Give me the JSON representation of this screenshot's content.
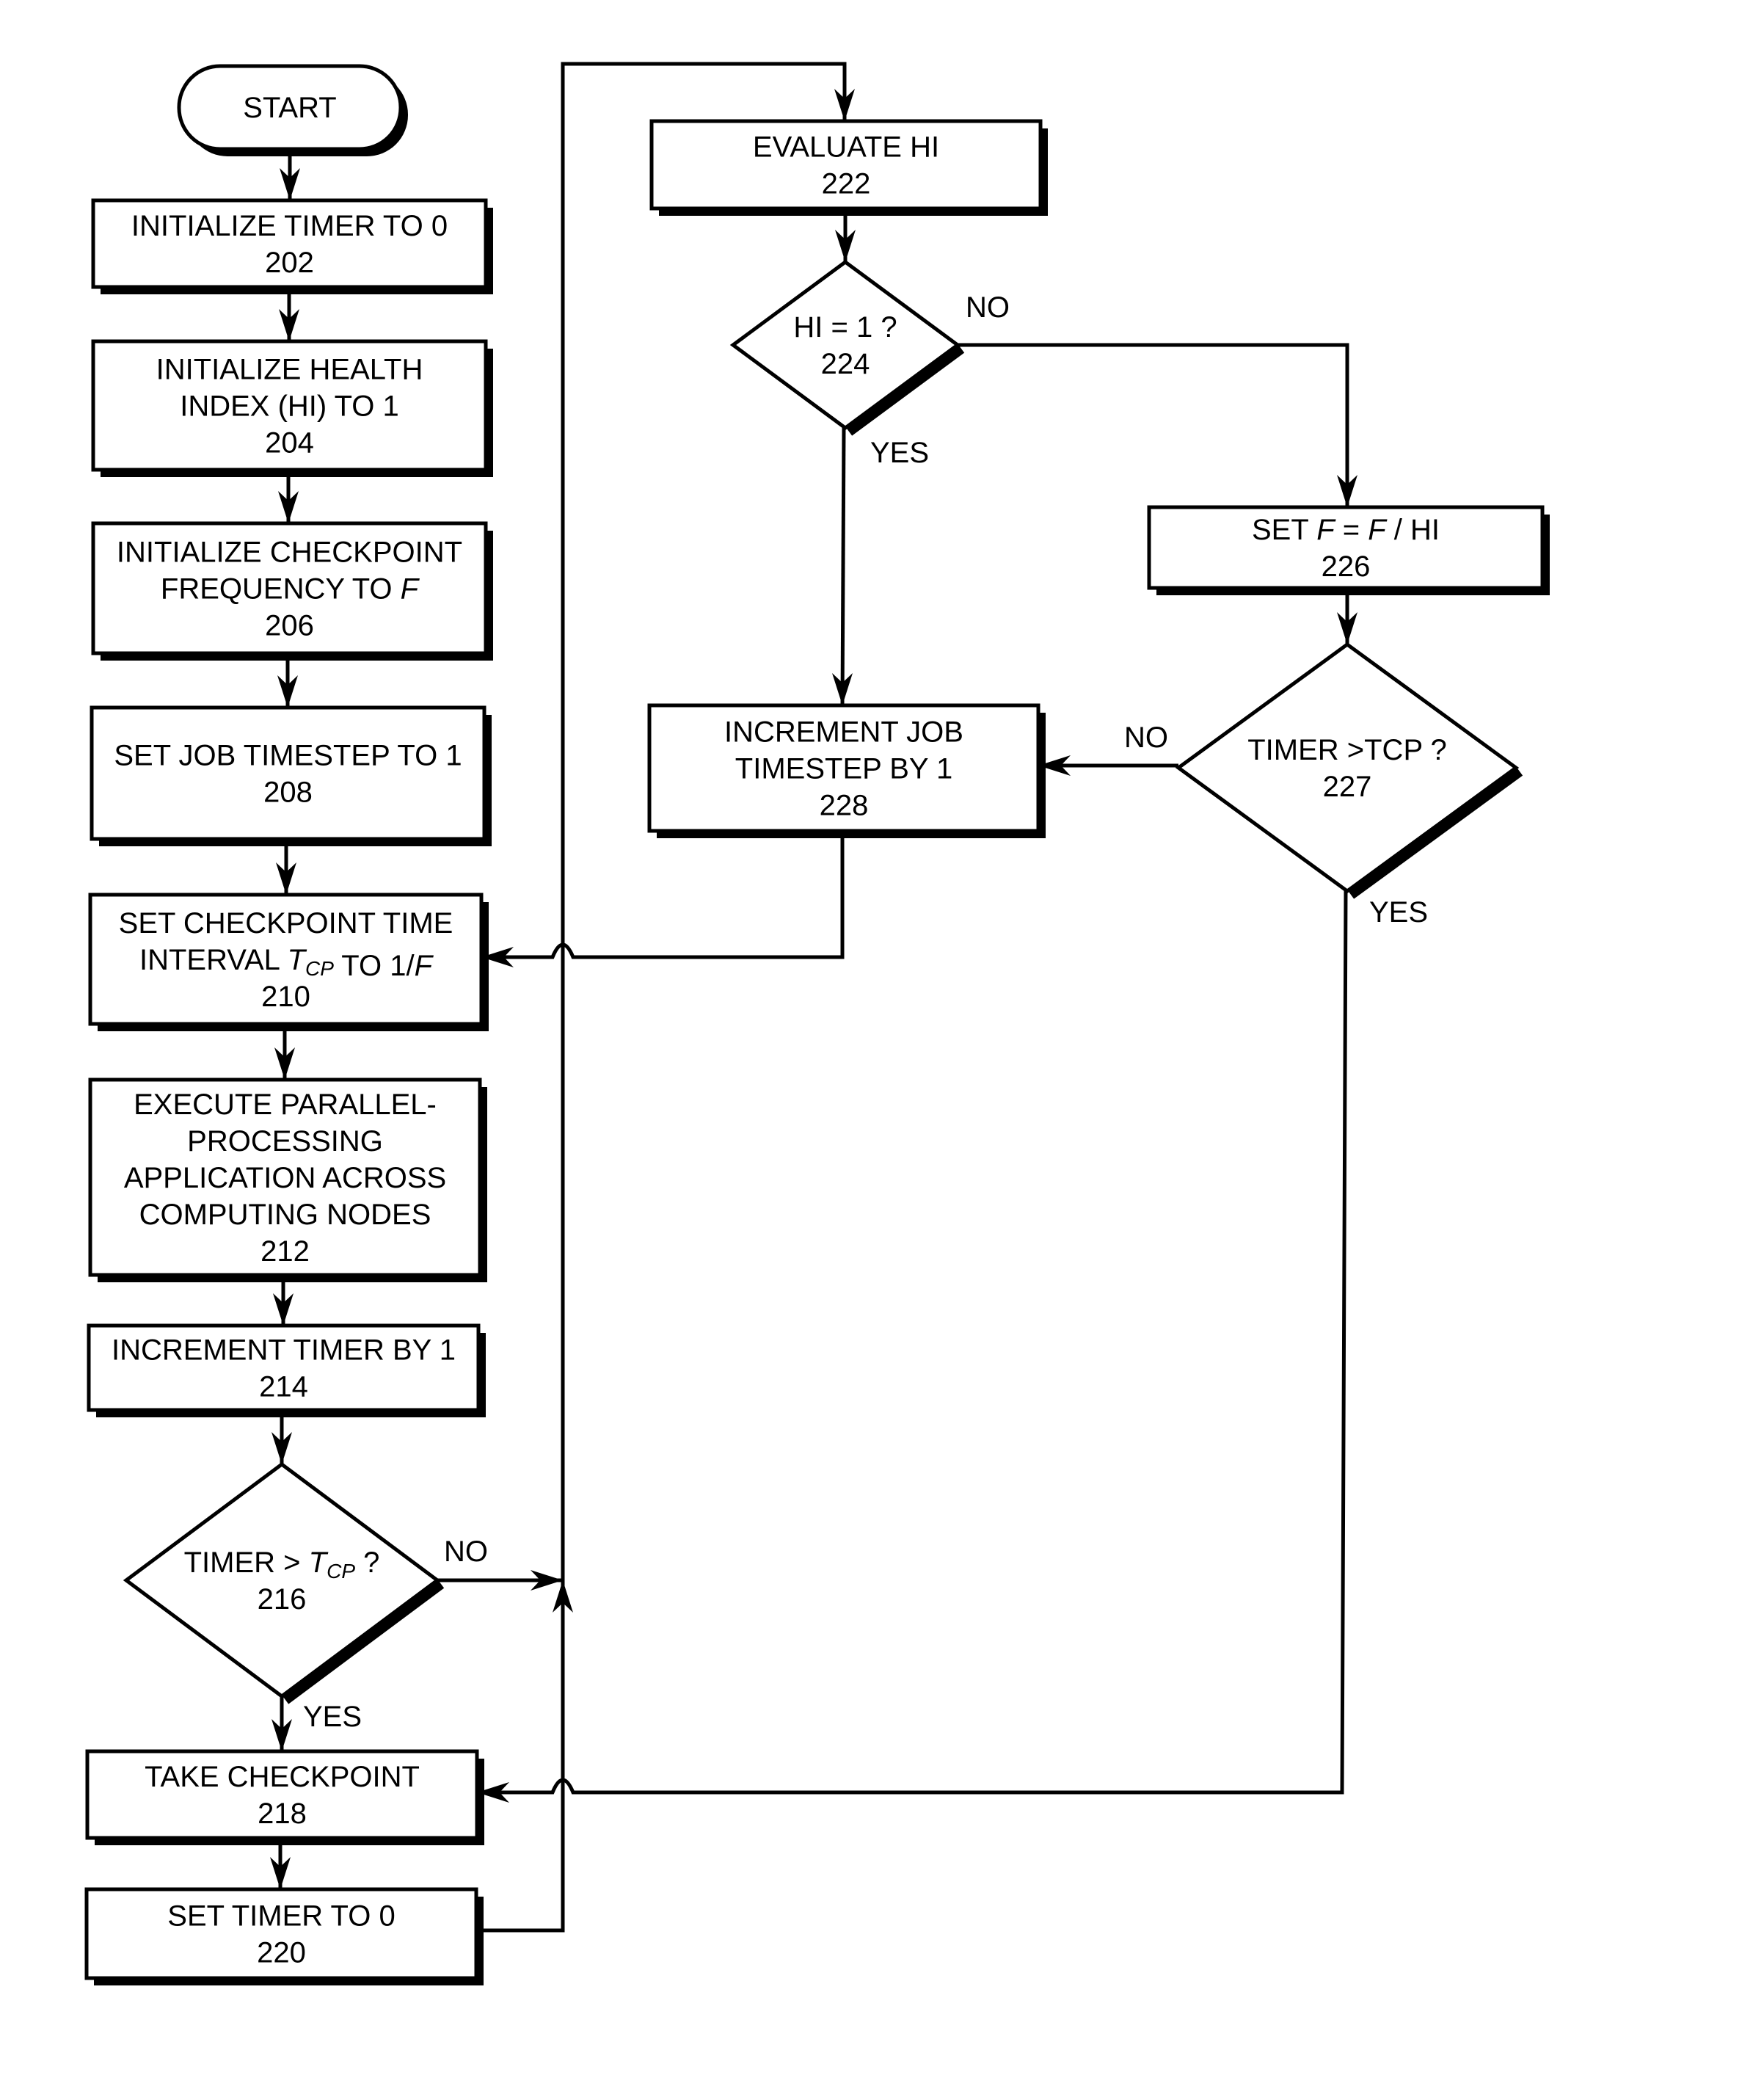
{
  "diagram": {
    "type": "flowchart",
    "start": {
      "id": "start",
      "label": "START"
    },
    "nodes": [
      {
        "id": "202",
        "kind": "process",
        "lines": [
          "INITIALIZE TIMER TO 0"
        ],
        "ref": "202"
      },
      {
        "id": "204",
        "kind": "process",
        "lines": [
          "INITIALIZE HEALTH",
          "INDEX (HI) TO 1"
        ],
        "ref": "204"
      },
      {
        "id": "206",
        "kind": "process",
        "lines": [
          "INITIALIZE CHECKPOINT",
          "FREQUENCY TO F"
        ],
        "ref": "206"
      },
      {
        "id": "208",
        "kind": "process",
        "lines": [
          "SET JOB TIMESTEP TO 1"
        ],
        "ref": "208"
      },
      {
        "id": "210",
        "kind": "process",
        "lines": [
          "SET CHECKPOINT TIME",
          "INTERVAL TCP TO 1/F"
        ],
        "ref": "210"
      },
      {
        "id": "212",
        "kind": "process",
        "lines": [
          "EXECUTE PARALLEL-",
          "PROCESSING",
          "APPLICATION ACROSS",
          "COMPUTING NODES"
        ],
        "ref": "212"
      },
      {
        "id": "214",
        "kind": "process",
        "lines": [
          "INCREMENT TIMER BY 1"
        ],
        "ref": "214"
      },
      {
        "id": "216",
        "kind": "decision",
        "lines": [
          "TIMER > TCP ?"
        ],
        "ref": "216"
      },
      {
        "id": "218",
        "kind": "process",
        "lines": [
          "TAKE CHECKPOINT"
        ],
        "ref": "218"
      },
      {
        "id": "220",
        "kind": "process",
        "lines": [
          "SET TIMER TO 0"
        ],
        "ref": "220"
      },
      {
        "id": "222",
        "kind": "process",
        "lines": [
          "EVALUATE HI"
        ],
        "ref": "222"
      },
      {
        "id": "224",
        "kind": "decision",
        "lines": [
          "HI = 1 ?"
        ],
        "ref": "224"
      },
      {
        "id": "226",
        "kind": "process",
        "lines": [
          "SET F = F / HI"
        ],
        "ref": "226"
      },
      {
        "id": "227",
        "kind": "decision",
        "lines": [
          "TIMER >TCP ?"
        ],
        "ref": "227"
      },
      {
        "id": "228",
        "kind": "process",
        "lines": [
          "INCREMENT JOB",
          "TIMESTEP BY 1"
        ],
        "ref": "228"
      }
    ],
    "edges": [
      {
        "from": "start",
        "to": "202",
        "label": ""
      },
      {
        "from": "202",
        "to": "204",
        "label": ""
      },
      {
        "from": "204",
        "to": "206",
        "label": ""
      },
      {
        "from": "206",
        "to": "208",
        "label": ""
      },
      {
        "from": "208",
        "to": "210",
        "label": ""
      },
      {
        "from": "210",
        "to": "212",
        "label": ""
      },
      {
        "from": "212",
        "to": "214",
        "label": ""
      },
      {
        "from": "214",
        "to": "216",
        "label": ""
      },
      {
        "from": "216",
        "to": "218",
        "label": "YES"
      },
      {
        "from": "216",
        "to": "222",
        "label": "NO"
      },
      {
        "from": "218",
        "to": "220",
        "label": ""
      },
      {
        "from": "220",
        "to": "222",
        "label": ""
      },
      {
        "from": "222",
        "to": "224",
        "label": ""
      },
      {
        "from": "224",
        "to": "228",
        "label": "YES"
      },
      {
        "from": "224",
        "to": "226",
        "label": "NO"
      },
      {
        "from": "226",
        "to": "227",
        "label": ""
      },
      {
        "from": "227",
        "to": "228",
        "label": "NO"
      },
      {
        "from": "227",
        "to": "218",
        "label": "YES"
      },
      {
        "from": "228",
        "to": "210",
        "label": ""
      }
    ],
    "edge_labels": {
      "no_216": "NO",
      "yes_216": "YES",
      "no_224": "NO",
      "yes_224": "YES",
      "no_227": "NO",
      "yes_227": "YES"
    }
  }
}
